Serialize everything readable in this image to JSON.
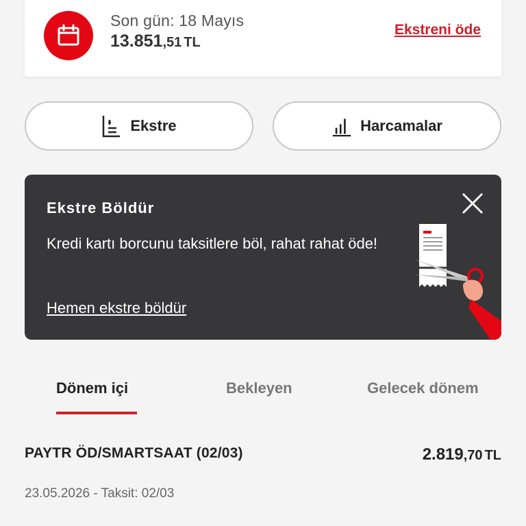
{
  "due": {
    "label": "Son gün: 18 Mayıs",
    "amount_int": "13.851",
    "amount_dec": ",51",
    "currency": "TL",
    "pay_link": "Ekstreni öde",
    "icon": "calendar-icon"
  },
  "actions": {
    "ekstre_label": "Ekstre",
    "harcamalar_label": "Harcamalar"
  },
  "promo": {
    "title": "Ekstre Böldür",
    "body": "Kredi kartı borcunu taksitlere böl, rahat rahat öde!",
    "link": "Hemen ekstre böldür"
  },
  "tabs": [
    {
      "label": "Dönem içi"
    },
    {
      "label": "Bekleyen"
    },
    {
      "label": "Gelecek dönem"
    }
  ],
  "transaction": {
    "name": "PAYTR ÖD/SMARTSAAT (02/03)",
    "amount_int": "2.819",
    "amount_dec": ",70",
    "currency": "TL",
    "meta": "23.05.2026 - Taksit: 02/03"
  },
  "colors": {
    "accent": "#e30613",
    "link": "#d11f2a",
    "banner_bg": "#37373a"
  }
}
